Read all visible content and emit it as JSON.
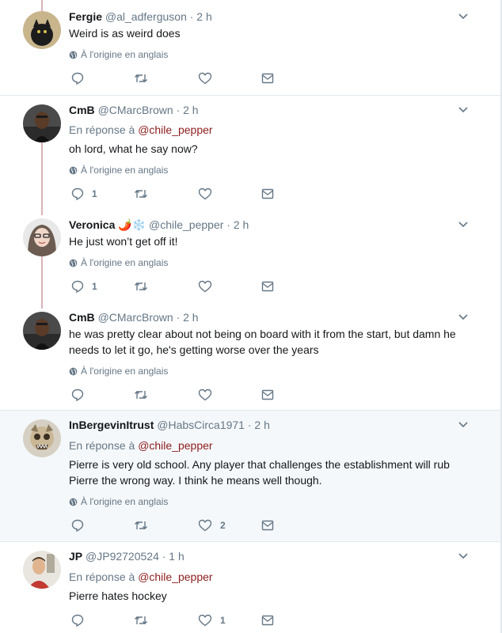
{
  "origin_label": "À l'origine en anglais",
  "reply_prefix": "En réponse à",
  "tweets": [
    {
      "name": "Fergie",
      "handle": "@al_adferguson",
      "time": "· 2 h",
      "reply_to": "",
      "text": "Weird is as weird does",
      "reply_count": "",
      "like_count": ""
    },
    {
      "name": "CmB",
      "handle": "@CMarcBrown",
      "time": "· 2 h",
      "reply_to": "@chile_pepper",
      "text": "oh lord, what he say now?",
      "reply_count": "1",
      "like_count": ""
    },
    {
      "name": "Veronica 🌶️❄️",
      "handle": "@chile_pepper",
      "time": "· 2 h",
      "reply_to": "",
      "text": "He just won’t get off it!",
      "reply_count": "1",
      "like_count": ""
    },
    {
      "name": "CmB",
      "handle": "@CMarcBrown",
      "time": "· 2 h",
      "reply_to": "",
      "text": "he was pretty clear about not being on board with it from the start, but damn he needs to let it go, he's getting worse over the years",
      "reply_count": "",
      "like_count": ""
    },
    {
      "name": "InBergevinItrust",
      "handle": "@HabsCirca1971",
      "time": "· 2 h",
      "reply_to": "@chile_pepper",
      "text": "Pierre is very old school. Any player that challenges the establishment will rub Pierre the wrong way. I think he means well though.",
      "reply_count": "",
      "like_count": "2"
    },
    {
      "name": "JP",
      "handle": "@JP92720524",
      "time": "· 1 h",
      "reply_to": "@chile_pepper",
      "text": "Pierre hates hockey",
      "reply_count": "",
      "like_count": "1"
    }
  ],
  "colors": {
    "text": "#14171a",
    "secondary": "#657786",
    "mention": "#8c1d1d",
    "thread_line": "#dab1b9",
    "highlight_bg": "#f5f8fa",
    "border": "#e1e8ed"
  },
  "icons": [
    "reply-icon",
    "retweet-icon",
    "like-icon",
    "message-icon",
    "globe-icon",
    "chevron-down-icon"
  ]
}
